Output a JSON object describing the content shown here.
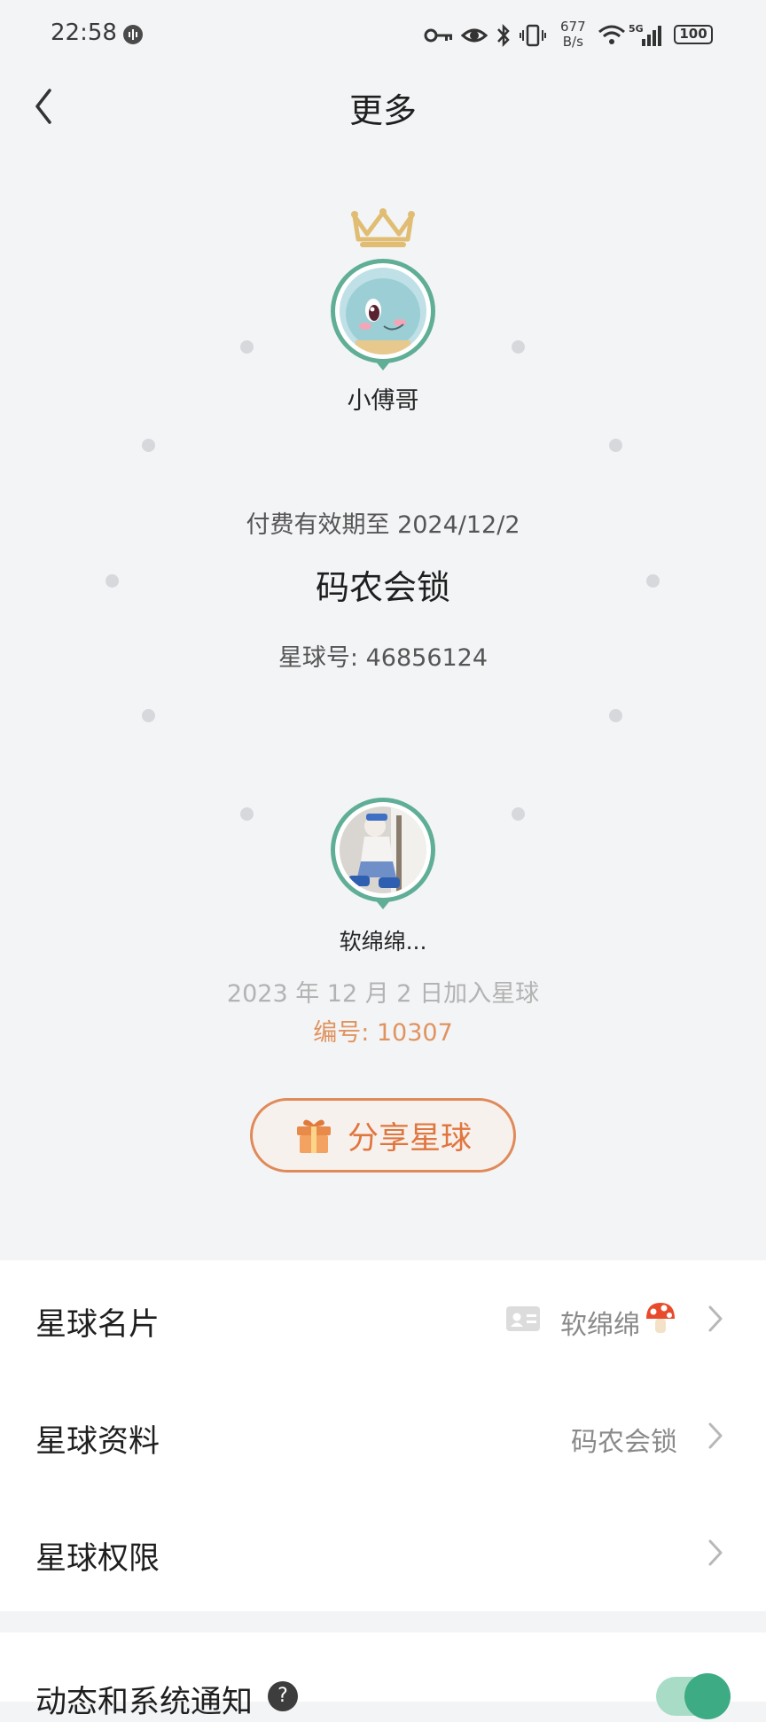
{
  "status_bar": {
    "time": "22:58",
    "net_speed_value": "677",
    "net_speed_unit": "B/s",
    "network": "5G",
    "battery": "100"
  },
  "header": {
    "title": "更多"
  },
  "owner": {
    "name": "小傅哥"
  },
  "group": {
    "expire_text": "付费有效期至 2024/12/2",
    "name": "码农会锁",
    "number_text": "星球号: 46856124"
  },
  "member": {
    "name": "软绵绵...",
    "join_text": "2023 年 12 月 2 日加入星球",
    "member_no_text": "编号: 10307"
  },
  "share_button": {
    "label": "分享星球"
  },
  "settings": [
    {
      "label": "星球名片",
      "value": "软绵绵"
    },
    {
      "label": "星球资料",
      "value": "码农会锁"
    },
    {
      "label": "星球权限",
      "value": ""
    }
  ],
  "notification": {
    "label": "动态和系统通知",
    "help": "?",
    "enabled": true
  },
  "colors": {
    "accent_green": "#5fae95",
    "share_orange": "#e0763e",
    "member_no_orange": "#e0935f",
    "toggle_on": "#3dab83"
  }
}
